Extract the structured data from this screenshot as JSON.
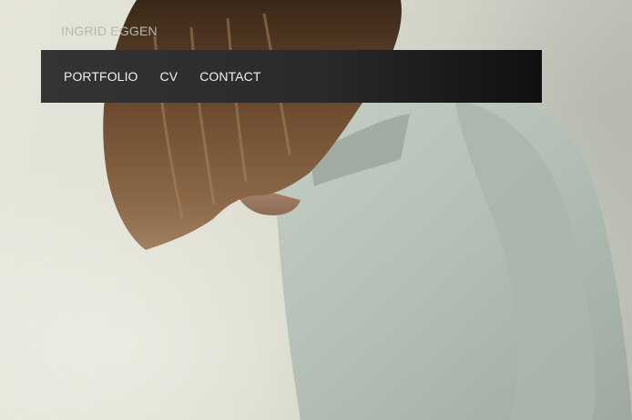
{
  "site": {
    "name": "INGRID EGGEN"
  },
  "nav": {
    "items": [
      {
        "label": "PORTFOLIO"
      },
      {
        "label": "CV"
      },
      {
        "label": "CONTACT"
      }
    ]
  },
  "colors": {
    "nav_bg": "#2a2a2a",
    "nav_text": "#f1f1f1",
    "site_name": "#b9b7ad",
    "wall": "#dcdccf",
    "sweater": "#b8c2b8",
    "hair": "#6b4a2e"
  }
}
